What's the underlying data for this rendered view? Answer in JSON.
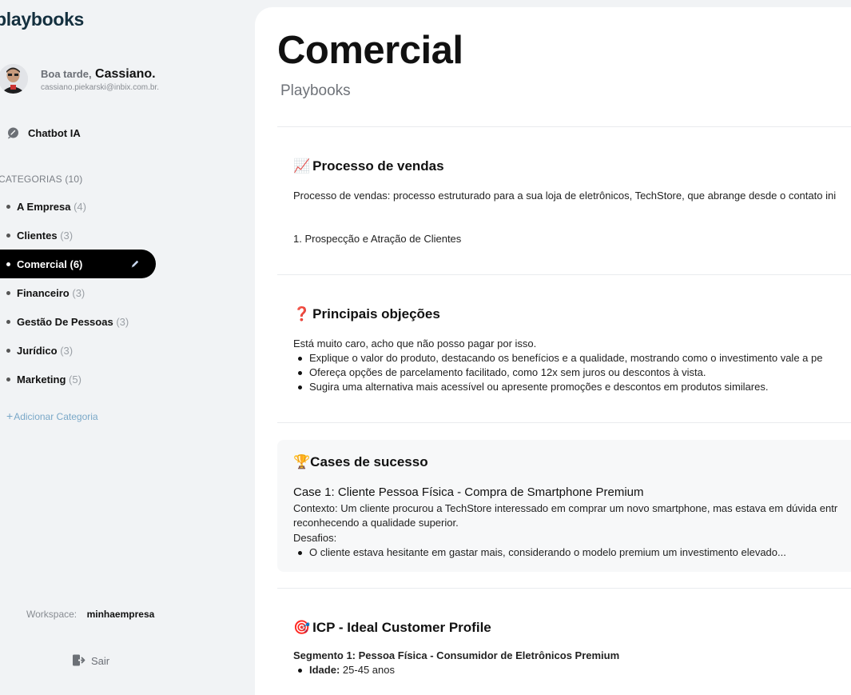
{
  "sidebar": {
    "brand": "playbooks",
    "user": {
      "greeting": "Boa tarde,",
      "name": "Cassiano.",
      "email": "cassiano.piekarski@inbix.com.br."
    },
    "chatbot": {
      "label": "Chatbot IA",
      "icon": "chat-bubble-icon"
    },
    "categories_heading": "CATEGORIAS (10)",
    "categories": [
      {
        "name": "A Empresa",
        "count": "(4)",
        "active": false
      },
      {
        "name": "Clientes",
        "count": "(3)",
        "active": false
      },
      {
        "name": "Comercial",
        "count": "(6)",
        "active": true
      },
      {
        "name": "Financeiro",
        "count": "(3)",
        "active": false
      },
      {
        "name": "Gestão De Pessoas",
        "count": "(3)",
        "active": false
      },
      {
        "name": "Jurídico",
        "count": "(3)",
        "active": false
      },
      {
        "name": "Marketing",
        "count": "(5)",
        "active": false
      }
    ],
    "add_category": "Adicionar Categoria",
    "workspace_label": "Workspace:",
    "workspace_value": "minhaempresa",
    "logout": "Sair"
  },
  "main": {
    "title": "Comercial",
    "subtitle": "Playbooks",
    "sections": {
      "processo": {
        "emoji": "📈",
        "title": "Processo de vendas",
        "line1": "Processo de vendas: processo estruturado para a sua loja de eletrônicos, TechStore, que abrange desde o contato ini",
        "line2": "1. Prospecção e Atração de Clientes"
      },
      "objecoes": {
        "emoji": "❓",
        "title": "Principais objeções",
        "intro": "Está muito caro, acho que não posso pagar por isso.",
        "bullets": [
          "Explique o valor do produto, destacando os benefícios e a qualidade, mostrando como o investimento vale a pe",
          "Ofereça opções de parcelamento facilitado, como 12x sem juros ou descontos à vista.",
          "Sugira uma alternativa mais acessível ou apresente promoções e descontos em produtos similares."
        ]
      },
      "cases": {
        "emoji": "🏆",
        "title": "Cases de sucesso",
        "case_title": "Case 1: Cliente Pessoa Física - Compra de Smartphone Premium",
        "context1": "Contexto: Um cliente procurou a TechStore interessado em comprar um novo smartphone, mas estava em dúvida entr",
        "context2": "reconhecendo a qualidade superior.",
        "challenges": "Desafios:",
        "bullets": [
          "O cliente estava hesitante em gastar mais, considerando o modelo premium um investimento elevado..."
        ]
      },
      "icp": {
        "emoji": "🎯",
        "title": "ICP - Ideal Customer Profile",
        "segment": "Segmento 1: Pessoa Física - Consumidor de Eletrônicos Premium",
        "age_label": "Idade:",
        "age_value": "25-45 anos"
      }
    }
  }
}
